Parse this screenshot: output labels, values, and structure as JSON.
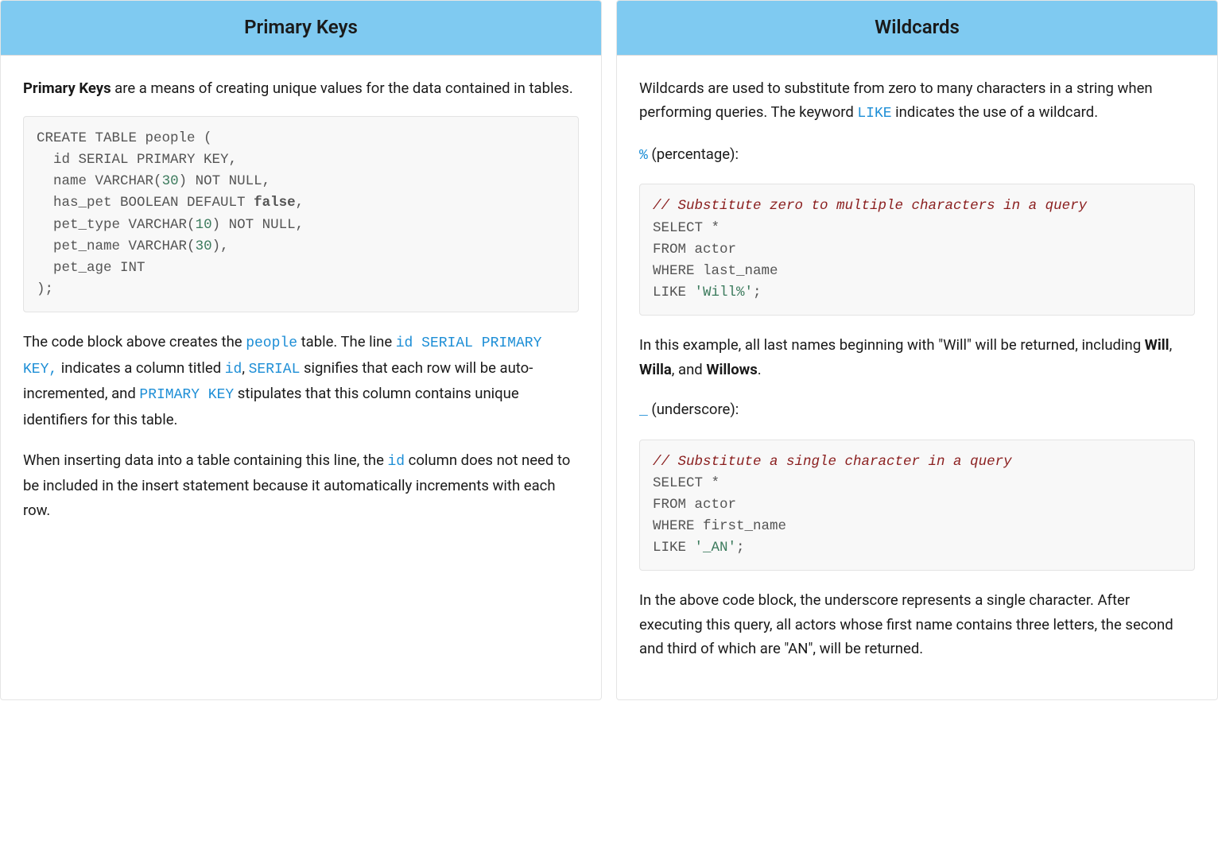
{
  "left": {
    "title": "Primary Keys",
    "intro_bold": "Primary Keys",
    "intro_rest": " are a means of creating unique values for the data contained in tables.",
    "code": {
      "l1_a": "CREATE TABLE people ",
      "l1_paren": "(",
      "l2_a": "  id SERIAL PRIMARY KEY",
      "l2_c": ",",
      "l3_a": "  name VARCHAR",
      "l3_p1": "(",
      "l3_n": "30",
      "l3_p2": ")",
      "l3_b": " NOT NULL",
      "l3_c": ",",
      "l4_a": "  has_pet BOOLEAN DEFAULT ",
      "l4_bool": "false",
      "l4_c": ",",
      "l5_a": "  pet_type VARCHAR",
      "l5_p1": "(",
      "l5_n": "10",
      "l5_p2": ")",
      "l5_b": " NOT NULL",
      "l5_c": ",",
      "l6_a": "  pet_name VARCHAR",
      "l6_p1": "(",
      "l6_n": "30",
      "l6_p2": ")",
      "l6_c": ",",
      "l7_a": "  pet_age INT",
      "l8_p": ");"
    },
    "para2": {
      "t1": "The code block above creates the ",
      "c1": "people",
      "t2": " table. The line ",
      "c2": "id SERIAL PRIMARY KEY,",
      "t3": " indicates a column titled ",
      "c3": "id",
      "t4": ", ",
      "c4": "SERIAL",
      "t5": " signifies that each row will be auto-incremented, and ",
      "c5": "PRIMARY KEY",
      "t6": " stipulates that this column contains unique identifiers for this table."
    },
    "para3": {
      "t1": "When inserting data into a table containing this line, the ",
      "c1": "id",
      "t2": " column does not need to be included in the insert statement because it automatically increments with each row."
    }
  },
  "right": {
    "title": "Wildcards",
    "intro": {
      "t1": "Wildcards are used to substitute from zero to many characters in a string when performing queries. The keyword ",
      "c1": "LIKE",
      "t2": " indicates the use of a wildcard."
    },
    "percent_lead": {
      "c": "%",
      "t": " (percentage):"
    },
    "code1": {
      "comment": "// Substitute zero to multiple characters in a query",
      "l2": "SELECT *",
      "l3": "FROM actor",
      "l4": "WHERE last_name",
      "l5a": "LIKE ",
      "l5s": "'Will%'",
      "l5c": ";"
    },
    "percent_after": {
      "t1": "In this example, all last names beginning with \"Will\" will be returned, including ",
      "b1": "Will",
      "sep1": ", ",
      "b2": "Willa",
      "sep2": ", and ",
      "b3": "Willows",
      "tend": "."
    },
    "underscore_lead": {
      "c": "_",
      "t": " (underscore):"
    },
    "code2": {
      "comment": "// Substitute a single character in a query",
      "l2": "SELECT *",
      "l3": "FROM actor",
      "l4": "WHERE first_name",
      "l5a": "LIKE ",
      "l5s": "'_AN'",
      "l5c": ";"
    },
    "underscore_after": "In the above code block, the underscore represents a single character. After executing this query, all actors whose first name contains three letters, the second and third of which are \"AN\", will be returned."
  }
}
